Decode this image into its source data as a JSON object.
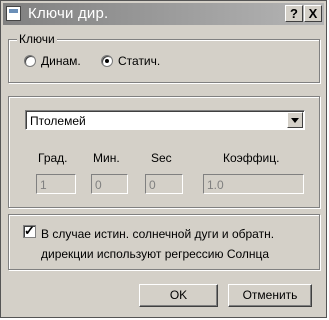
{
  "window": {
    "title": "Ключи дир.",
    "help_label": "?",
    "close_label": "X"
  },
  "keys_group": {
    "legend": "Ключи",
    "options": [
      {
        "label": "Динам.",
        "checked": false
      },
      {
        "label": "Статич.",
        "checked": true
      }
    ]
  },
  "params": {
    "select_value": "Птолемей",
    "fields": [
      {
        "label": "Град.",
        "value": "1"
      },
      {
        "label": "Мин.",
        "value": "0"
      },
      {
        "label": "Sec",
        "value": "0"
      },
      {
        "label": "Коэффиц.",
        "value": "1.0"
      }
    ]
  },
  "option": {
    "checked": true,
    "label": "В случае истин. солнечной дуги и обратн. дирекции используют регрессию Солнца"
  },
  "buttons": {
    "ok": "OK",
    "cancel": "Отменить"
  }
}
